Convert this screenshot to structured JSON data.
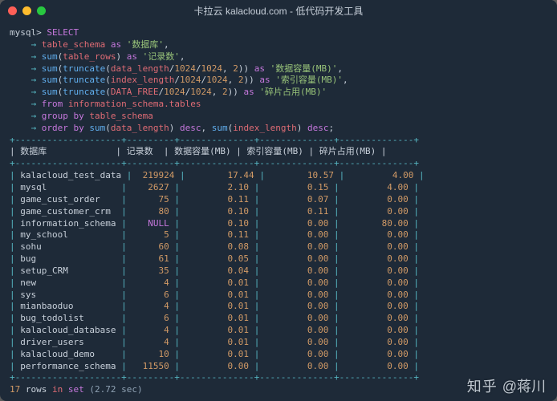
{
  "window": {
    "title": "卡拉云 kalacloud.com - 低代码开发工具"
  },
  "sql": {
    "prompt": "mysql>",
    "arrow": "→",
    "lines": {
      "l0a": "SELECT",
      "l1a": "table_schema",
      "l1b": "as",
      "l1c": "'数据库'",
      "l2a": "sum",
      "l2b": "table_rows",
      "l2c": "as",
      "l2d": "'记录数'",
      "l3a": "sum",
      "l3b": "truncate",
      "l3c": "data_length",
      "l3d": "1024",
      "l3e": "1024",
      "l3f": "2",
      "l3g": "as",
      "l3h": "'数据容量(MB)'",
      "l4a": "sum",
      "l4b": "truncate",
      "l4c": "index_length",
      "l4d": "1024",
      "l4e": "1024",
      "l4f": "2",
      "l4g": "as",
      "l4h": "'索引容量(MB)'",
      "l5a": "sum",
      "l5b": "truncate",
      "l5c": "DATA_FREE",
      "l5d": "1024",
      "l5e": "1024",
      "l5f": "2",
      "l5g": "as",
      "l5h": "'碎片占用(MB)'",
      "l6a": "from",
      "l6b": "information_schema.tables",
      "l7a": "group by",
      "l7b": "table_schema",
      "l8a": "order by",
      "l8b": "sum",
      "l8c": "data_length",
      "l8d": "desc",
      "l8e": "sum",
      "l8f": "index_length",
      "l8g": "desc"
    }
  },
  "table": {
    "border_top": "+--------------------+---------+--------------+--------------+--------------+",
    "border_mid": "+--------------------+---------+--------------+--------------+--------------+",
    "header": {
      "c0": "数据库",
      "c1": "记录数",
      "c2": "数据容量(MB)",
      "c3": "索引容量(MB)",
      "c4": "碎片占用(MB)"
    },
    "rows": [
      {
        "name": "kalacloud_test_data",
        "r": "219924",
        "d": "17.44",
        "i": "10.57",
        "f": "4.00"
      },
      {
        "name": "mysql",
        "r": "2627",
        "d": "2.10",
        "i": "0.15",
        "f": "4.00"
      },
      {
        "name": "game_cust_order",
        "r": "75",
        "d": "0.11",
        "i": "0.07",
        "f": "0.00"
      },
      {
        "name": "game_customer_crm",
        "r": "80",
        "d": "0.10",
        "i": "0.11",
        "f": "0.00"
      },
      {
        "name": "information_schema",
        "r": "NULL",
        "d": "0.10",
        "i": "0.00",
        "f": "80.00"
      },
      {
        "name": "my_school",
        "r": "5",
        "d": "0.11",
        "i": "0.00",
        "f": "0.00"
      },
      {
        "name": "sohu",
        "r": "60",
        "d": "0.08",
        "i": "0.00",
        "f": "0.00"
      },
      {
        "name": "bug",
        "r": "61",
        "d": "0.05",
        "i": "0.00",
        "f": "0.00"
      },
      {
        "name": "setup_CRM",
        "r": "35",
        "d": "0.04",
        "i": "0.00",
        "f": "0.00"
      },
      {
        "name": "new",
        "r": "4",
        "d": "0.01",
        "i": "0.00",
        "f": "0.00"
      },
      {
        "name": "sys",
        "r": "6",
        "d": "0.01",
        "i": "0.00",
        "f": "0.00"
      },
      {
        "name": "mianbaoduo",
        "r": "4",
        "d": "0.01",
        "i": "0.00",
        "f": "0.00"
      },
      {
        "name": "bug_todolist",
        "r": "6",
        "d": "0.01",
        "i": "0.00",
        "f": "0.00"
      },
      {
        "name": "kalacloud_database",
        "r": "4",
        "d": "0.01",
        "i": "0.00",
        "f": "0.00"
      },
      {
        "name": "driver_users",
        "r": "4",
        "d": "0.01",
        "i": "0.00",
        "f": "0.00"
      },
      {
        "name": "kalacloud_demo",
        "r": "10",
        "d": "0.01",
        "i": "0.00",
        "f": "0.00"
      },
      {
        "name": "performance_schema",
        "r": "11550",
        "d": "0.00",
        "i": "0.00",
        "f": "0.00"
      }
    ]
  },
  "footer": {
    "rows": "17",
    "word_rows": "rows",
    "word_in": "in",
    "word_set": "set",
    "time": "(2.72 sec)"
  },
  "watermark": {
    "site": "知乎",
    "author": "@蒋川"
  }
}
